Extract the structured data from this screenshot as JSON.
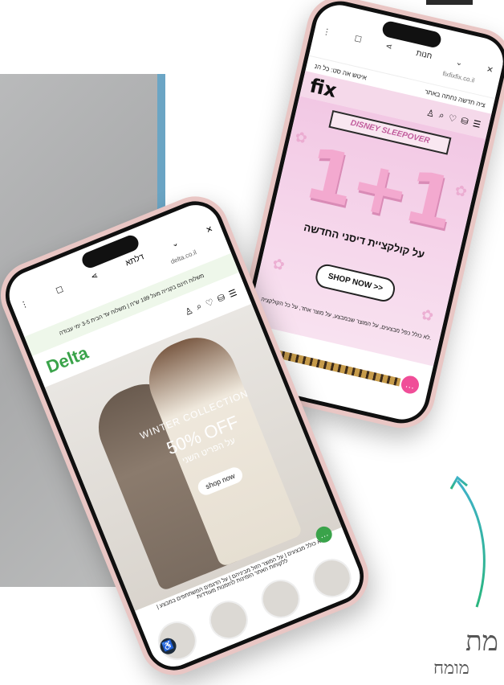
{
  "fix_phone": {
    "browser_title": "חנות",
    "browser_url": "fixfixfix.co.il",
    "promo_left": "איטש אה סט: כל הנ",
    "promo_right": "ציה חדשה נחתה באתר",
    "logo": "fix",
    "banner": "DISNEY SLEEPOVER",
    "big_number": "1+1",
    "headline": "על קולקציית דיסני החדשה",
    "shop_button": "SHOP NOW >>",
    "fine_print": "לא כולל כפל מבצעים, על המוצר שבמבצע, על מוצר אחד, על כל הקולקציה."
  },
  "delta_phone": {
    "browser_title": "דלתא",
    "browser_url": "delta.co.il",
    "promo": "משלוח חינם בקנייה מעל 199 ש\"ח | משלוח עד הבית 3-5 ימי עבודה",
    "logo": "Delta",
    "hero_collection": "WINTER COLLECTION",
    "hero_offer": "50% OFF",
    "hero_offer_sub": "על הפריט השני",
    "shop_button": "shop now",
    "fine_print": "לא כולל מבצעים | על המוצר הזול מביניהם | על הדגמים המשתתפים במבצע | ללקוחות האתר הזמינות להזמנות מעודדות"
  },
  "bottom_text": {
    "line1": "מת",
    "line2": "מומח"
  },
  "colors": {
    "fix_pink": "#f2c8e4",
    "delta_green": "#3aa34a",
    "phone_frame": "#e9c6c4",
    "arrow_gradient_start": "#3fb1c9",
    "arrow_gradient_end": "#2ab67e"
  }
}
